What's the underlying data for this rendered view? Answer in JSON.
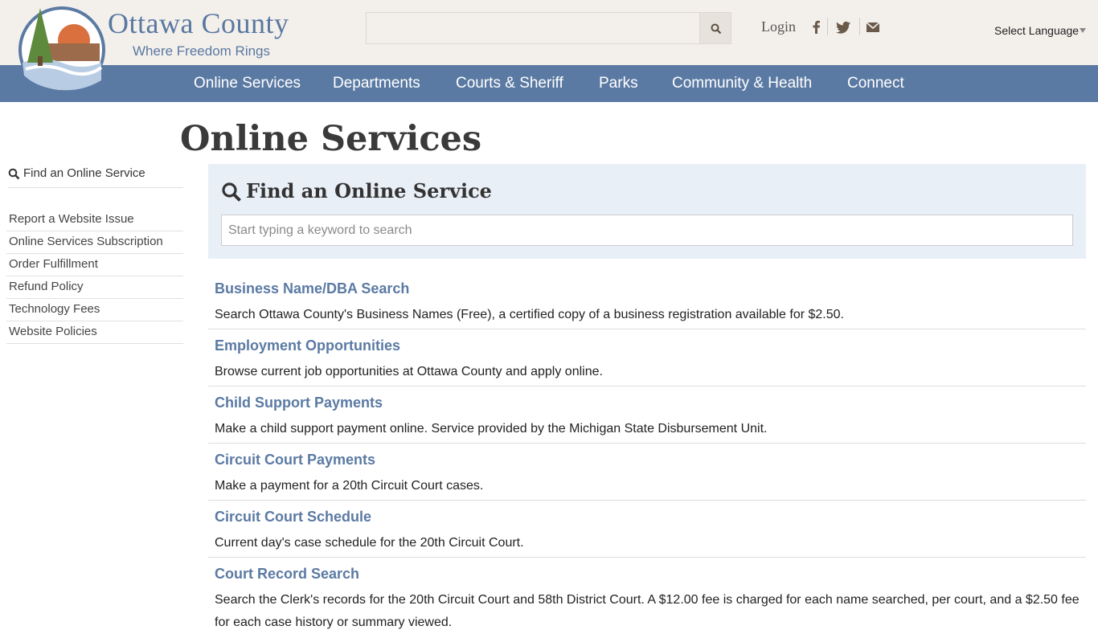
{
  "header": {
    "brand_name": "Ottawa County",
    "brand_tagline": "Where Freedom Rings",
    "search_placeholder": "",
    "login_label": "Login",
    "language_label": "Select Language",
    "colors": {
      "header_bg": "#f3f0ec",
      "nav_bg": "#5b7aa3",
      "accent": "#5b7aa3"
    }
  },
  "nav": {
    "items": [
      {
        "label": "Online Services"
      },
      {
        "label": "Departments"
      },
      {
        "label": "Courts & Sheriff"
      },
      {
        "label": "Parks"
      },
      {
        "label": "Community & Health"
      },
      {
        "label": "Connect"
      }
    ]
  },
  "page": {
    "title": "Online Services"
  },
  "sidebar": {
    "find_label": "Find an Online Service",
    "items": [
      {
        "label": "Report a Website Issue"
      },
      {
        "label": "Online Services Subscription"
      },
      {
        "label": "Order Fulfillment"
      },
      {
        "label": "Refund Policy"
      },
      {
        "label": "Technology Fees"
      },
      {
        "label": "Website Policies"
      }
    ]
  },
  "finder": {
    "title": "Find an Online Service",
    "placeholder": "Start typing a keyword to search"
  },
  "services": [
    {
      "title": "Business Name/DBA Search",
      "description": "Search Ottawa County's Business Names (Free), a certified copy of a business registration available for $2.50."
    },
    {
      "title": "Employment Opportunities",
      "description": "Browse current job opportunities at Ottawa County and apply online."
    },
    {
      "title": "Child Support Payments",
      "description": "Make a child support payment online. Service provided by the Michigan State Disbursement Unit."
    },
    {
      "title": "Circuit Court Payments",
      "description": "Make a payment for a 20th Circuit Court cases."
    },
    {
      "title": "Circuit Court Schedule",
      "description": "Current day's case schedule for the 20th Circuit Court."
    },
    {
      "title": "Court Record Search",
      "description": "Search the Clerk's records for the 20th Circuit Court and 58th District Court. A $12.00 fee is charged for each name searched, per court, and a $2.50 fee for each case history or summary viewed."
    }
  ]
}
